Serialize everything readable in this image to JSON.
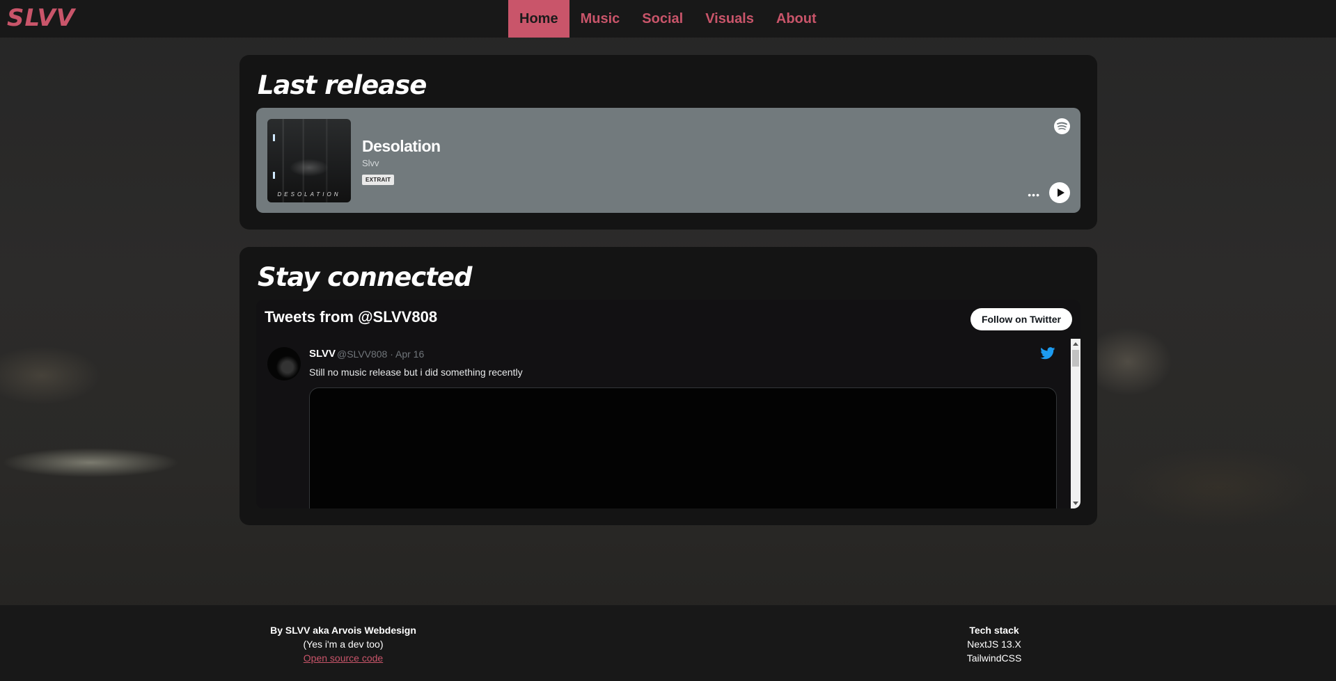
{
  "nav": {
    "logo": "SLVV",
    "links": [
      {
        "label": "Home",
        "active": true
      },
      {
        "label": "Music"
      },
      {
        "label": "Social"
      },
      {
        "label": "Visuals"
      },
      {
        "label": "About"
      }
    ]
  },
  "colors": {
    "accent": "#c9556a",
    "card": "#141414",
    "spotify_bg": "#727a7d",
    "footer": "#181818"
  },
  "release": {
    "title": "Last release",
    "embed": {
      "cover_text": "DESOLATION",
      "track_title": "Desolation",
      "artist": "Slvv",
      "badge": "EXTRAIT",
      "icons": [
        "spotify-icon",
        "more-icon",
        "play-icon"
      ]
    }
  },
  "connected": {
    "title": "Stay connected",
    "twitter": {
      "header": "Tweets from @SLVV808",
      "follow_label": "Follow on Twitter",
      "tweet": {
        "name": "SLVV",
        "handle_date": "@SLVV808 · Apr 16",
        "text": "Still no music release but i did something recently"
      }
    }
  },
  "footer": {
    "credit": "By SLVV aka Arvois Webdesign",
    "note": "(Yes i'm a dev too)",
    "source_link": "Open source code",
    "stack_title": "Tech stack",
    "stack": [
      "NextJS 13.X",
      "TailwindCSS"
    ]
  }
}
